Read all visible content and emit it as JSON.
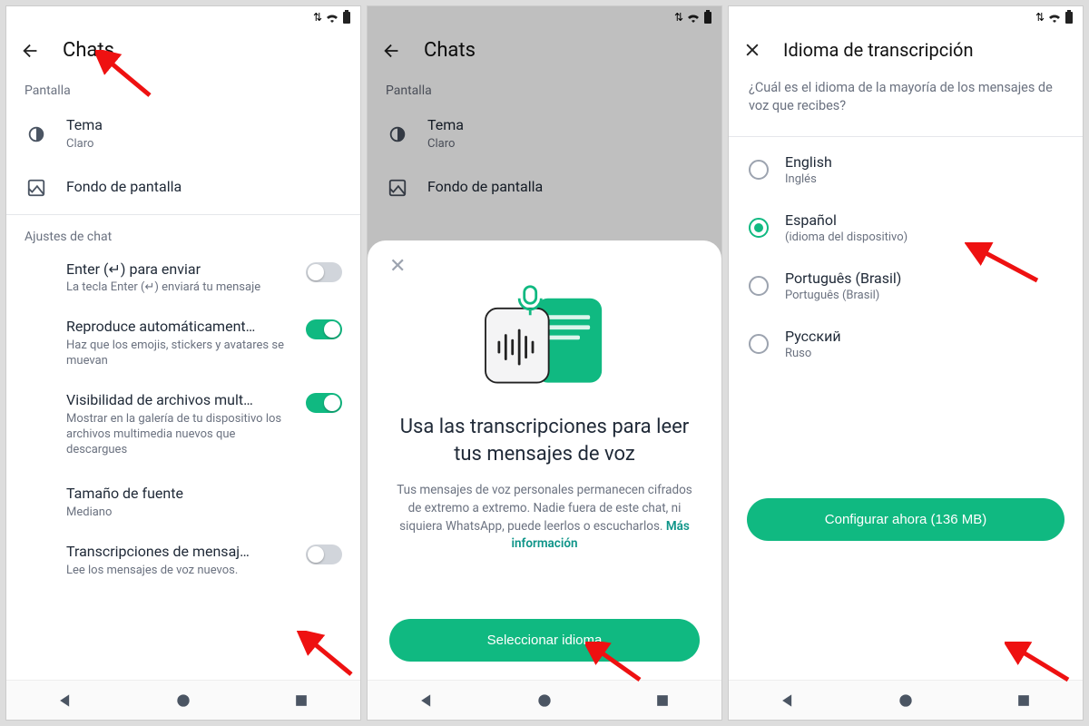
{
  "accent": "#10b981",
  "screen1": {
    "title": "Chats",
    "section_display": "Pantalla",
    "theme": {
      "label": "Tema",
      "value": "Claro"
    },
    "wallpaper": "Fondo de pantalla",
    "section_chat": "Ajustes de chat",
    "enter": {
      "label": "Enter (↵) para enviar",
      "desc": "La tecla Enter (↵) enviará tu mensaje",
      "on": false
    },
    "autoplay": {
      "label": "Reproduce automáticament…",
      "desc": "Haz que los emojis, stickers y avatares se muevan",
      "on": true
    },
    "media": {
      "label": "Visibilidad de archivos mult…",
      "desc": "Mostrar en la galería de tu dispositivo los archivos multimedia nuevos que descargues",
      "on": true
    },
    "fontsize": {
      "label": "Tamaño de fuente",
      "value": "Mediano"
    },
    "transcribe": {
      "label": "Transcripciones de mensaj…",
      "desc": "Lee los mensajes de voz nuevos.",
      "on": false
    }
  },
  "screen2": {
    "title": "Chats",
    "section_display": "Pantalla",
    "theme": {
      "label": "Tema",
      "value": "Claro"
    },
    "wallpaper": "Fondo de pantalla",
    "sheet": {
      "title": "Usa las transcripciones para leer tus mensajes de voz",
      "body": "Tus mensajes de voz personales permanecen cifrados de extremo a extremo. Nadie fuera de este chat, ni siquiera WhatsApp, puede leerlos o escucharlos.",
      "link": "Más información",
      "cta": "Seleccionar idioma"
    }
  },
  "screen3": {
    "title": "Idioma de transcripción",
    "question": "¿Cuál es el idioma de la mayoría de los mensajes de voz que recibes?",
    "languages": [
      {
        "name": "English",
        "sub": "Inglés",
        "selected": false
      },
      {
        "name": "Español",
        "sub": "(idioma del dispositivo)",
        "selected": true
      },
      {
        "name": "Português (Brasil)",
        "sub": "Português (Brasil)",
        "selected": false
      },
      {
        "name": "Русский",
        "sub": "Ruso",
        "selected": false
      }
    ],
    "cta": "Configurar ahora (136 MB)"
  }
}
